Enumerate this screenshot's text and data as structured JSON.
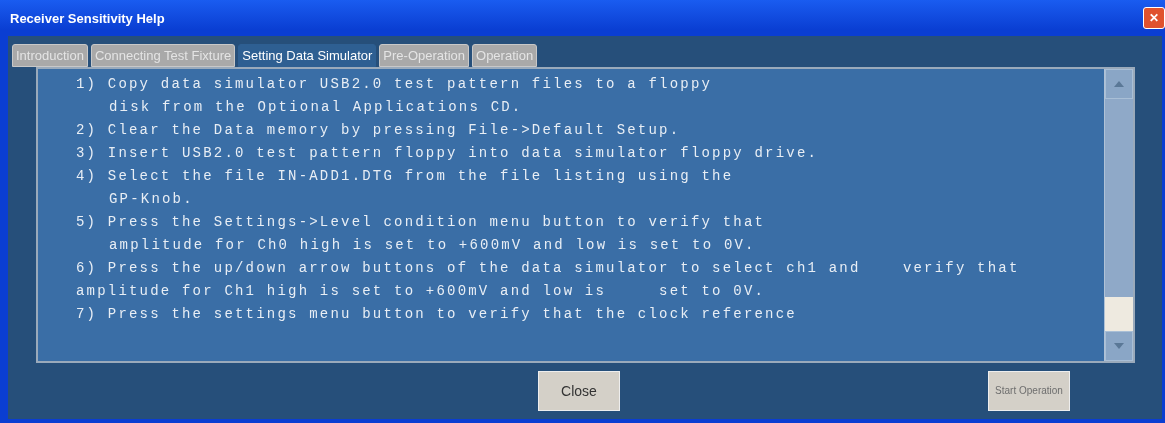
{
  "window": {
    "title": "Receiver Sensitivity Help",
    "close_symbol": "✕"
  },
  "tabs": [
    {
      "label": "Introduction",
      "selected": false
    },
    {
      "label": "Connecting Test Fixture",
      "selected": false
    },
    {
      "label": "Setting Data Simulator",
      "selected": true
    },
    {
      "label": "Pre-Operation",
      "selected": false
    },
    {
      "label": "Operation",
      "selected": false
    }
  ],
  "content": {
    "lines": [
      {
        "kind": "numbered",
        "text": "1) Copy data simulator USB2.0 test pattern files to a floppy"
      },
      {
        "kind": "wrapped",
        "text": "disk from the Optional Applications CD."
      },
      {
        "kind": "numbered",
        "text": "2) Clear the Data memory by pressing File->Default Setup."
      },
      {
        "kind": "numbered",
        "text": "3) Insert USB2.0 test pattern floppy into data simulator floppy drive."
      },
      {
        "kind": "numbered",
        "text": "4) Select the file IN-ADD1.DTG from the file listing using the"
      },
      {
        "kind": "wrapped",
        "text": "GP-Knob."
      },
      {
        "kind": "numbered",
        "text": "5) Press the Settings->Level condition menu button to verify that"
      },
      {
        "kind": "wrapped",
        "text": "amplitude for Ch0 high is set to +600mV and low is set to 0V."
      },
      {
        "kind": "numbered",
        "text": "6) Press the up/down arrow buttons of the data simulator to select ch1 and    verify that"
      },
      {
        "kind": "flush",
        "text": "amplitude for Ch1 high is set to +600mV and low is     set to 0V."
      },
      {
        "kind": "numbered",
        "text": "7) Press the settings menu button to verify that the clock reference"
      }
    ]
  },
  "buttons": [
    {
      "label": "Close",
      "disabled": false
    },
    {
      "label": "Start Operation",
      "disabled": true
    }
  ]
}
